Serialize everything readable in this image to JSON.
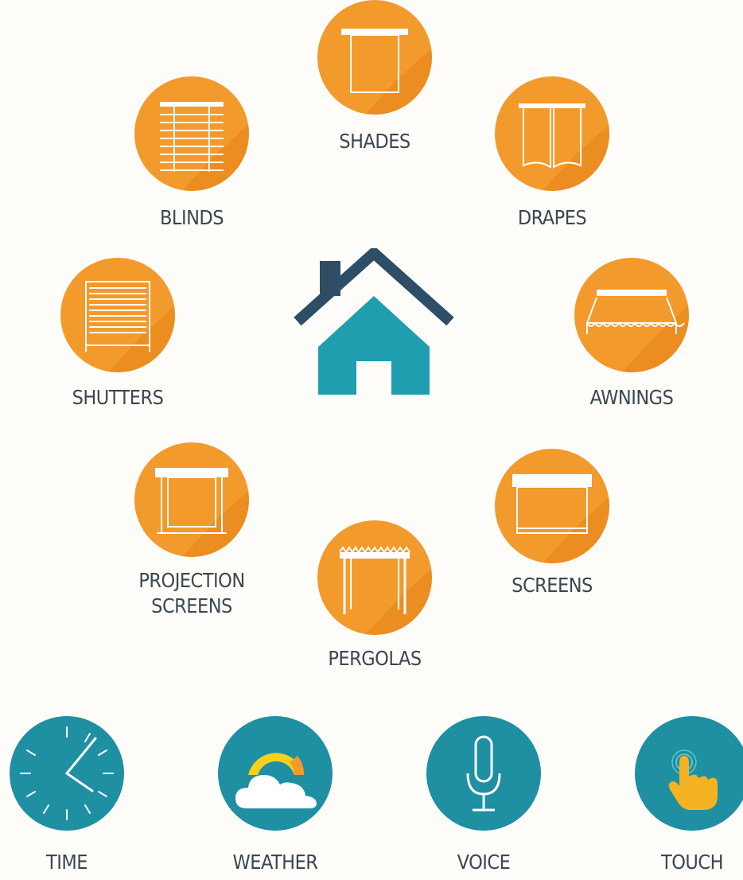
{
  "products": [
    {
      "id": "shades",
      "label": "SHADES",
      "icon": "shade-icon"
    },
    {
      "id": "blinds",
      "label": "BLINDS",
      "icon": "blinds-icon"
    },
    {
      "id": "drapes",
      "label": "DRAPES",
      "icon": "drapes-icon"
    },
    {
      "id": "shutters",
      "label": "SHUTTERS",
      "icon": "shutters-icon"
    },
    {
      "id": "awnings",
      "label": "AWNINGS",
      "icon": "awning-icon"
    },
    {
      "id": "projection",
      "label_line1": "PROJECTION",
      "label_line2": "SCREENS",
      "icon": "projection-screen-icon"
    },
    {
      "id": "screens",
      "label": "SCREENS",
      "icon": "screen-icon"
    },
    {
      "id": "pergolas",
      "label": "PERGOLAS",
      "icon": "pergola-icon"
    }
  ],
  "controls": [
    {
      "id": "time",
      "label": "TIME",
      "icon": "clock-icon"
    },
    {
      "id": "weather",
      "label": "WEATHER",
      "icon": "weather-icon"
    },
    {
      "id": "voice",
      "label": "VOICE",
      "icon": "microphone-icon"
    },
    {
      "id": "touch",
      "label": "TOUCH",
      "icon": "touch-hand-icon"
    }
  ],
  "center_icon": "house-icon",
  "colors": {
    "orange": "#f39a2c",
    "teal": "#1f8fa2",
    "house_body": "#1f9eb0",
    "house_roof": "#2d4e66",
    "text": "#3a4750"
  }
}
